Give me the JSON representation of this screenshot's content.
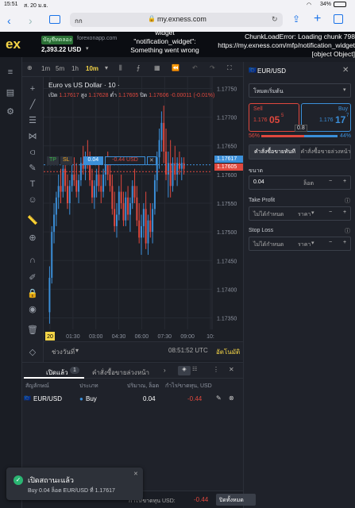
{
  "status_bar": {
    "time": "15:51",
    "date": "ส. 20 ม.ย.",
    "battery": "34%"
  },
  "browser": {
    "url": "my.exness.com",
    "tab_label": "กก"
  },
  "app_header": {
    "logo": "ex",
    "account_type": "บัญชีทดลอง",
    "server": "forexonapp.com",
    "balance": "2,393.22 USD",
    "error_left": "widget \"notification_widget\": Something went wrong",
    "error_right": "ChunkLoadError: Loading chunk 798 https://my.exness.com/mfp/notification_widget [object Object]"
  },
  "chart_toolbar": {
    "timeframes": [
      "1m",
      "5m",
      "1h"
    ],
    "active_tf": "10m"
  },
  "chart_header": {
    "title": "Euro vs US Dollar · 10 ·",
    "open_label": "เปิด",
    "open": "1.17617",
    "high_label": "สูง",
    "high": "1.17628",
    "low_label": "ต่ำ",
    "low": "1.17605",
    "close_label": "ปิด",
    "close": "1.17606",
    "change": "-0.00011 (-0.01%)"
  },
  "position_line": {
    "tp": "TP",
    "sl": "SL",
    "volume": "0.04",
    "pnl": "-0.44 USD"
  },
  "price_badges": {
    "ask": "1.17617",
    "bid": "1.17605"
  },
  "chart_data": {
    "type": "candlestick",
    "y_ticks": [
      "1.17750",
      "1.17700",
      "1.17650",
      "1.17600",
      "1.17550",
      "1.17500",
      "1.17450",
      "1.17400",
      "1.17350"
    ],
    "x_ticks": [
      "20",
      "01:30",
      "03:00",
      "04:30",
      "06:00",
      "07:30",
      "09:00",
      "10:"
    ],
    "ylim": [
      1.1733,
      1.1777
    ],
    "candles": [
      [
        1.1736,
        1.1744,
        1.1734,
        1.1742
      ],
      [
        1.1742,
        1.1751,
        1.1741,
        1.175
      ],
      [
        1.175,
        1.1755,
        1.1748,
        1.1753
      ],
      [
        1.1753,
        1.1757,
        1.1751,
        1.1756
      ],
      [
        1.1756,
        1.176,
        1.1754,
        1.1758
      ],
      [
        1.1758,
        1.1761,
        1.1755,
        1.1757
      ],
      [
        1.1757,
        1.1762,
        1.1756,
        1.1761
      ],
      [
        1.1761,
        1.1763,
        1.1757,
        1.1758
      ],
      [
        1.1758,
        1.176,
        1.1754,
        1.1755
      ],
      [
        1.1755,
        1.1759,
        1.1753,
        1.1758
      ],
      [
        1.1758,
        1.1762,
        1.1757,
        1.176
      ],
      [
        1.176,
        1.1763,
        1.1758,
        1.1759
      ],
      [
        1.1759,
        1.1762,
        1.1756,
        1.1757
      ],
      [
        1.1757,
        1.176,
        1.1755,
        1.1759
      ],
      [
        1.1759,
        1.1763,
        1.1758,
        1.1762
      ],
      [
        1.1762,
        1.1765,
        1.176,
        1.1761
      ],
      [
        1.1761,
        1.1764,
        1.1759,
        1.1763
      ],
      [
        1.1763,
        1.1766,
        1.1761,
        1.1762
      ],
      [
        1.1762,
        1.1764,
        1.1758,
        1.1759
      ],
      [
        1.1759,
        1.1761,
        1.1755,
        1.1756
      ],
      [
        1.1756,
        1.1759,
        1.1754,
        1.1758
      ],
      [
        1.1758,
        1.1761,
        1.1756,
        1.176
      ],
      [
        1.176,
        1.1762,
        1.1757,
        1.1758
      ],
      [
        1.1758,
        1.176,
        1.1755,
        1.1757
      ],
      [
        1.1757,
        1.1761,
        1.1756,
        1.176
      ],
      [
        1.176,
        1.1763,
        1.1758,
        1.1762
      ],
      [
        1.1762,
        1.1764,
        1.1759,
        1.176
      ],
      [
        1.176,
        1.1762,
        1.1757,
        1.1758
      ],
      [
        1.1758,
        1.176,
        1.1753,
        1.1754
      ],
      [
        1.1754,
        1.1757,
        1.175,
        1.1751
      ],
      [
        1.1751,
        1.1755,
        1.1749,
        1.1753
      ],
      [
        1.1753,
        1.1758,
        1.1752,
        1.1757
      ],
      [
        1.1757,
        1.176,
        1.1754,
        1.1755
      ],
      [
        1.1755,
        1.1757,
        1.1751,
        1.1752
      ],
      [
        1.1752,
        1.1757,
        1.1751,
        1.1756
      ],
      [
        1.1756,
        1.1758,
        1.1752,
        1.1753
      ],
      [
        1.1753,
        1.1756,
        1.175,
        1.1755
      ],
      [
        1.1755,
        1.1759,
        1.1754,
        1.1758
      ],
      [
        1.1758,
        1.1761,
        1.1755,
        1.1756
      ],
      [
        1.1756,
        1.1758,
        1.1751,
        1.1752
      ],
      [
        1.1752,
        1.1755,
        1.1748,
        1.1749
      ],
      [
        1.1749,
        1.1753,
        1.1746,
        1.1751
      ],
      [
        1.1751,
        1.1755,
        1.1749,
        1.1754
      ],
      [
        1.1754,
        1.1757,
        1.1747,
        1.1748
      ],
      [
        1.1748,
        1.1753,
        1.1746,
        1.1752
      ],
      [
        1.1752,
        1.1755,
        1.1749,
        1.175
      ],
      [
        1.175,
        1.1755,
        1.1748,
        1.1754
      ],
      [
        1.1754,
        1.176,
        1.1753,
        1.1759
      ],
      [
        1.1759,
        1.1764,
        1.1757,
        1.1763
      ],
      [
        1.1763,
        1.1768,
        1.1761,
        1.1766
      ],
      [
        1.1766,
        1.1771,
        1.1764,
        1.1769
      ],
      [
        1.1769,
        1.1772,
        1.1762,
        1.1764
      ],
      [
        1.1764,
        1.1768,
        1.1759,
        1.176
      ],
      [
        1.176,
        1.1764,
        1.1756,
        1.1762
      ],
      [
        1.1762,
        1.1766,
        1.1756,
        1.1758
      ],
      [
        1.1758,
        1.1763,
        1.1757,
        1.1762
      ],
      [
        1.1762,
        1.1765,
        1.1759,
        1.176
      ],
      [
        1.176,
        1.1763,
        1.1758,
        1.1762
      ],
      [
        1.1762,
        1.1764,
        1.176,
        1.1761
      ],
      [
        1.1761,
        1.1763,
        1.1759,
        1.1762
      ],
      [
        1.1762,
        1.1763,
        1.176,
        1.1761
      ]
    ]
  },
  "chart_footer": {
    "range_label": "ช่วงวันที่",
    "clock": "08:51:52 UTC",
    "auto": "อัตโนมัติ"
  },
  "order_panel": {
    "symbol": "EUR/USD",
    "mode": "โหมดเริ่มต้น",
    "sell_label": "Sell",
    "sell_price_main": "1.176",
    "sell_price_big": "05",
    "sell_sup": "5",
    "buy_label": "Buy",
    "buy_price_main": "1.176",
    "buy_price_big": "17",
    "buy_sup": "7",
    "spread": "0.8",
    "sell_pct": "56%",
    "buy_pct": "44%",
    "tab_market": "คำสั่งซื้อขายทันที",
    "tab_pending": "คำสั่งซื้อขายล่วงหน้า",
    "volume_label": "ขนาด",
    "volume_value": "0.04",
    "volume_unit": "ล็อต",
    "tp_label": "Take Profit",
    "tp_value": "ไม่ได้กำหนด",
    "tp_unit": "ราคา",
    "sl_label": "Stop Loss",
    "sl_value": "ไม่ได้กำหนด",
    "sl_unit": "ราคา",
    "minus": "−",
    "plus": "+"
  },
  "positions": {
    "tab_open": "เปิดแล้ว",
    "open_count": "1",
    "tab_pending": "คำสั่งซื้อขายล่วงหน้า",
    "headers": [
      "สัญลักษณ์",
      "ประเภท",
      "ปริมาณ, ล็อต",
      "กำไร/ขาดทุน, USD"
    ],
    "rows": [
      {
        "symbol": "EUR/USD",
        "type": "Buy",
        "volume": "0.04",
        "pnl": "-0.44"
      }
    ]
  },
  "footer": {
    "total_label": "กำไร/ขาดทุน USD:",
    "total_value": "-0.44",
    "close_all": "ปิดทั้งหมด"
  },
  "toast": {
    "title": "เปิดสถานะแล้ว",
    "body": "Buy 0.04 ล็อต EUR/USD ที่ 1.17617"
  },
  "colors": {
    "up": "#3b8fd9",
    "down": "#e0483e",
    "accent": "#f5d547",
    "brand": "#1a73e8"
  }
}
